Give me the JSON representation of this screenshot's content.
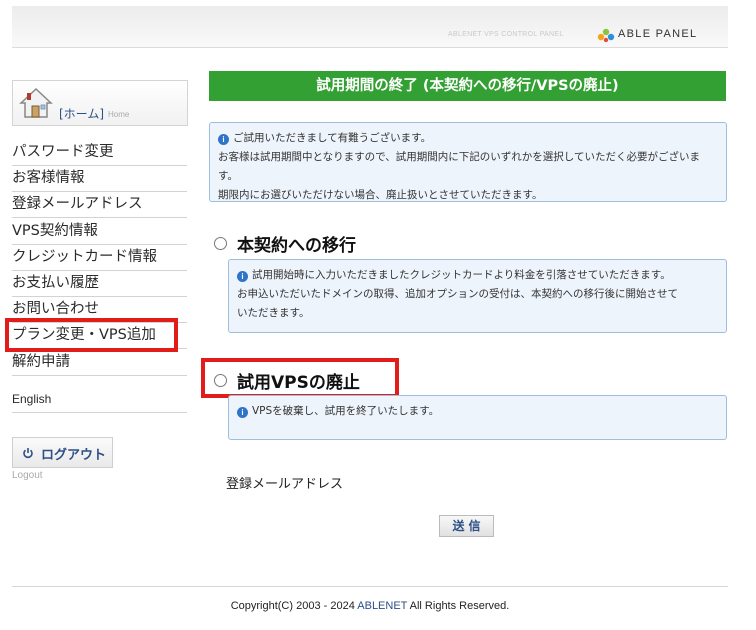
{
  "header": {
    "subtitle": "ABLENET VPS CONTROL PANEL",
    "logo_text": "ABLE PANEL"
  },
  "sidebar": {
    "home_label": "[ホーム]",
    "home_sub": "Home",
    "items": [
      {
        "label": "パスワード変更"
      },
      {
        "label": "お客様情報"
      },
      {
        "label": "登録メールアドレス"
      },
      {
        "label": "VPS契約情報"
      },
      {
        "label": "クレジットカード情報"
      },
      {
        "label": "お支払い履歴"
      },
      {
        "label": "お問い合わせ"
      },
      {
        "label": "プラン変更・VPS追加"
      },
      {
        "label": "解約申請"
      },
      {
        "label": "English"
      }
    ],
    "logout_label": "ログアウト",
    "logout_sub": "Logout"
  },
  "main": {
    "title": "試用期間の終了 (本契約への移行/VPSの廃止)",
    "intro_lines": [
      "ご試用いただきまして有難うございます。",
      "お客様は試用期間中となりますので、試用期間内に下記のいずれかを選択していただく必要がございます。",
      "期限内にお選びいただけない場合、廃止扱いとさせていただきます。"
    ],
    "option1": {
      "label": "本契約への移行",
      "info_lines": [
        "試用開始時に入力いただきましたクレジットカードより料金を引落させていただきます。",
        "お申込いただいたドメインの取得、追加オプションの受付は、本契約への移行後に開始させて",
        "いただきます。"
      ]
    },
    "option2": {
      "label": "試用VPSの廃止",
      "info_lines": [
        "VPSを破棄し、試用を終了いたします。"
      ]
    },
    "email_label": "登録メールアドレス",
    "submit_label": "送信"
  },
  "footer": {
    "copyright_prefix": "Copyright(C) 2003 - 2024 ",
    "brand": "ABLENET",
    "copyright_suffix": " All Rights Reserved."
  },
  "colors": {
    "accent_green": "#33a033",
    "highlight_red": "#e21b1b",
    "link_blue": "#2c4f86",
    "info_bg": "#eef4fb"
  },
  "icons": [
    "house-icon",
    "info-icon",
    "power-icon",
    "logo-dots-icon"
  ]
}
